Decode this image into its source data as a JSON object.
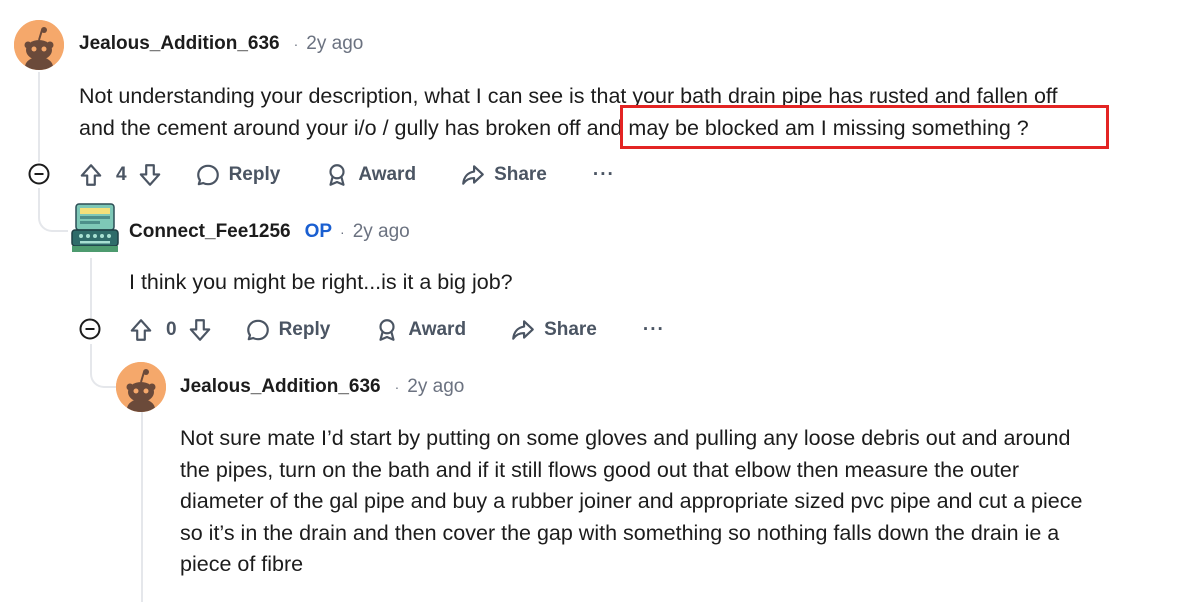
{
  "comments": [
    {
      "author": "Jealous_Addition_636",
      "separator": "·",
      "time": "2y ago",
      "body_line1": "Not understanding your description, what I can see is that your bath drain pipe has rusted and fallen off",
      "body_line2_pre": "and the cement around your i/o / gully has broken off ",
      "body_line2_highlight": "and may be blocked am I missing something ?",
      "votes": "4",
      "reply_label": "Reply",
      "award_label": "Award",
      "share_label": "Share",
      "more_label": "···"
    },
    {
      "author": "Connect_Fee1256",
      "op_badge": "OP",
      "separator": "·",
      "time": "2y ago",
      "body": "I think you might be right...is it a big job?",
      "votes": "0",
      "reply_label": "Reply",
      "award_label": "Award",
      "share_label": "Share",
      "more_label": "···"
    },
    {
      "author": "Jealous_Addition_636",
      "separator": "·",
      "time": "2y ago",
      "body_lines": [
        "Not sure mate I’d start by putting on some gloves and pulling any loose debris out and around",
        "the pipes, turn on the bath and if it still flows good out that elbow then measure the outer",
        "diameter of the gal pipe and buy a rubber joiner and appropriate sized pvc pipe and cut a piece",
        "so it’s in the drain and then cover the gap with something so nothing falls down the drain ie a",
        "piece of fibre"
      ]
    }
  ],
  "colors": {
    "highlight_box": "#e32423",
    "op_badge": "#1a5fd1",
    "avatar_bg": "#f5a86b",
    "thread_line": "#e5e7eb"
  }
}
